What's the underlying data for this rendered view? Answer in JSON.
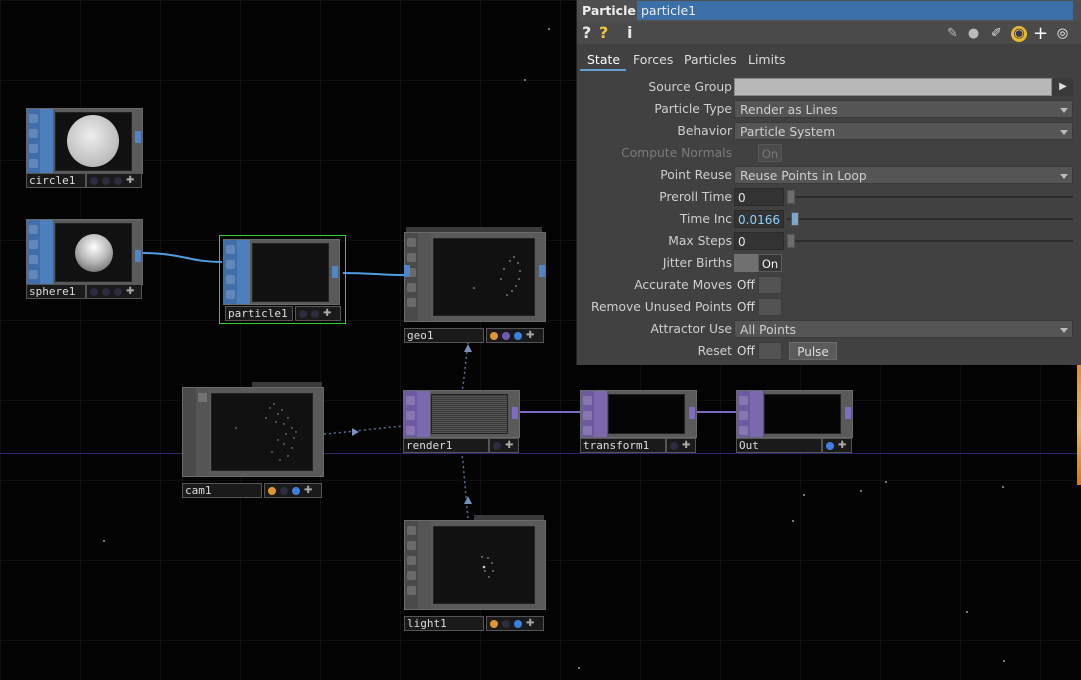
{
  "nodes": {
    "circle1": {
      "label": "circle1"
    },
    "sphere1": {
      "label": "sphere1"
    },
    "particle1": {
      "label": "particle1"
    },
    "geo1": {
      "label": "geo1"
    },
    "cam1": {
      "label": "cam1"
    },
    "render1": {
      "label": "render1"
    },
    "transform1": {
      "label": "transform1"
    },
    "out": {
      "label": "Out"
    },
    "light1": {
      "label": "light1"
    }
  },
  "panel": {
    "op_type": "Particle",
    "op_name": "particle1",
    "toolbar": {
      "help": "?",
      "help_python": "?",
      "info": "i"
    },
    "right_icons": [
      "pencil-icon",
      "comment-icon",
      "clipboard-icon",
      "python-icon",
      "plus-icon",
      "target-icon"
    ],
    "tabs": [
      {
        "label": "State"
      },
      {
        "label": "Forces"
      },
      {
        "label": "Particles"
      },
      {
        "label": "Limits"
      }
    ],
    "params": {
      "source_group": {
        "label": "Source Group",
        "value": ""
      },
      "particle_type": {
        "label": "Particle Type",
        "value": "Render as Lines"
      },
      "behavior": {
        "label": "Behavior",
        "value": "Particle System"
      },
      "compute_normals": {
        "label": "Compute Normals",
        "value": "On"
      },
      "point_reuse": {
        "label": "Point Reuse",
        "value": "Reuse Points in Loop"
      },
      "preroll_time": {
        "label": "Preroll Time",
        "value": "0"
      },
      "time_inc": {
        "label": "Time Inc",
        "value": "0.0166"
      },
      "max_steps": {
        "label": "Max Steps",
        "value": "0"
      },
      "jitter_births": {
        "label": "Jitter Births",
        "value": "On"
      },
      "accurate_moves": {
        "label": "Accurate Moves",
        "value": "Off"
      },
      "remove_unused": {
        "label": "Remove Unused Points",
        "value": "Off"
      },
      "attractor_use": {
        "label": "Attractor Use",
        "value": "All Points"
      },
      "reset": {
        "label": "Reset",
        "value": "Off",
        "button": "Pulse"
      }
    }
  },
  "colors": {
    "sop": "#3f6ea8",
    "top": "#6d5aa0",
    "selected": "#2cd42c",
    "wire_sop": "#4f9ee0",
    "wire_top": "#7d6cc0"
  }
}
